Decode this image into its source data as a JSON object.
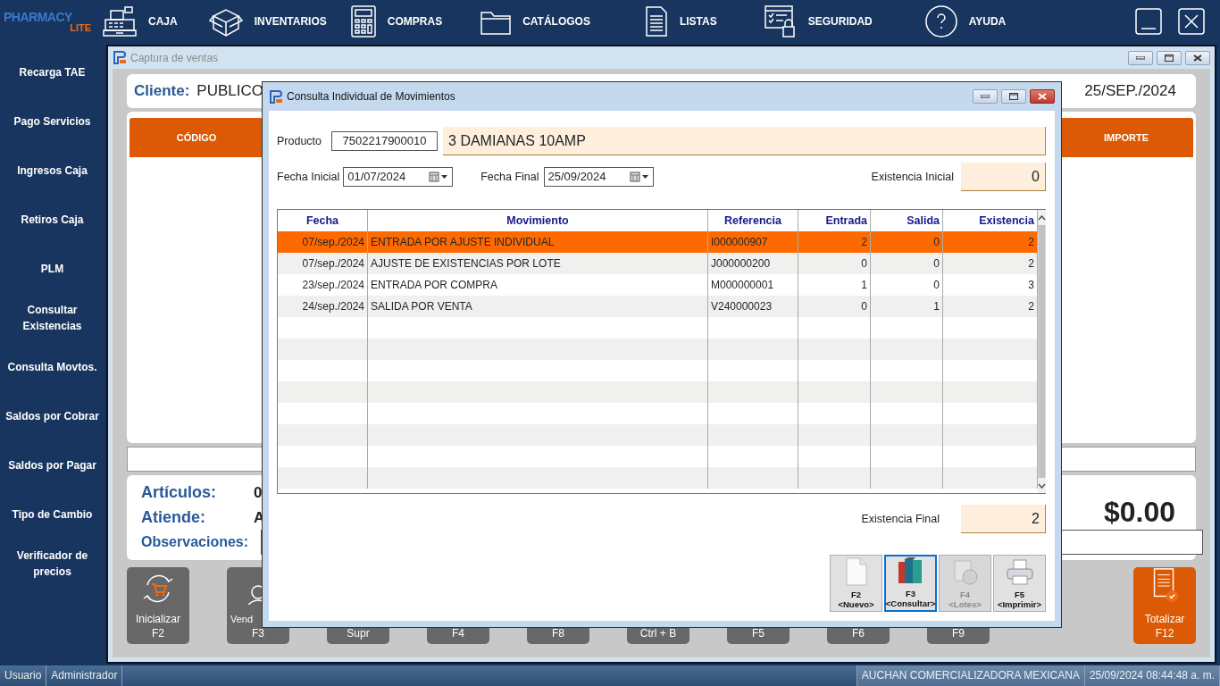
{
  "app": {
    "logo_line1": "PHARMACY",
    "logo_line2": "LITE"
  },
  "menu": [
    {
      "label": "CAJA"
    },
    {
      "label": "INVENTARIOS"
    },
    {
      "label": "COMPRAS"
    },
    {
      "label": "CATÁLOGOS"
    },
    {
      "label": "LISTAS"
    },
    {
      "label": "SEGURIDAD"
    },
    {
      "label": "AYUDA"
    }
  ],
  "sidebar": {
    "items": [
      "Recarga TAE",
      "Pago Servicios",
      "Ingresos Caja",
      "Retiros Caja",
      "PLM",
      "Consultar Existencias",
      "Consulta Movtos.",
      "Saldos por Cobrar",
      "Saldos por Pagar",
      "Tipo  de Cambio",
      "Verificador de precios"
    ]
  },
  "sales_window": {
    "title": "Captura de ventas",
    "client_label": "Cliente:",
    "client": "PUBLICO",
    "date": "25/SEP./2024",
    "columns": [
      "CÓDIGO",
      "IMPORTE"
    ],
    "items_label": "Artículos:",
    "items_value": "0",
    "attendant_label": "Atiende:",
    "attendant_value": "A",
    "notes_label": "Observaciones:",
    "total": "$0.00",
    "buttons": [
      {
        "kind": "normal",
        "label": "Inicializar",
        "key": "F2"
      },
      {
        "kind": "normal",
        "label": "Vend",
        "key": "F3"
      },
      {
        "kind": "normal",
        "key": "Supr"
      },
      {
        "kind": "normal",
        "key": "F4"
      },
      {
        "kind": "normal",
        "key": "F8"
      },
      {
        "kind": "normal",
        "key": "Ctrl + B"
      },
      {
        "kind": "normal",
        "key": "F5"
      },
      {
        "kind": "normal",
        "key": "F6"
      },
      {
        "kind": "normal",
        "key": "F9"
      },
      {
        "kind": "primary",
        "label": "Totalizar",
        "key": "F12"
      }
    ]
  },
  "dialog": {
    "title": "Consulta Individual de Movimientos",
    "product_label": "Producto",
    "product_code": "7502217900010",
    "product_name": "3 DAMIANAS 10AMP",
    "start_label": "Fecha Inicial",
    "start_date": "01/07/2024",
    "end_label": "Fecha Final",
    "end_date": "25/09/2024",
    "initial_label": "Existencia Inicial",
    "initial_value": "0",
    "table": {
      "columns": [
        "Fecha",
        "Movimiento",
        "Referencia",
        "Entrada",
        "Salida",
        "Existencia"
      ],
      "rows": [
        {
          "selected": true,
          "cells": [
            "07/sep./2024",
            "ENTRADA POR AJUSTE INDIVIDUAL",
            "I000000907",
            "2",
            "0",
            "2"
          ]
        },
        {
          "selected": false,
          "cells": [
            "07/sep./2024",
            "AJUSTE DE EXISTENCIAS POR LOTE",
            "J000000200",
            "0",
            "0",
            "2"
          ]
        },
        {
          "selected": false,
          "cells": [
            "23/sep./2024",
            "ENTRADA POR COMPRA",
            "M000000001",
            "1",
            "0",
            "3"
          ]
        },
        {
          "selected": false,
          "cells": [
            "24/sep./2024",
            "SALIDA POR VENTA",
            "V240000023",
            "0",
            "1",
            "2"
          ]
        }
      ]
    },
    "final_label": "Existencia Final",
    "final_value": "2",
    "buttons": [
      {
        "key": "F2",
        "label": "<Nuevo>",
        "disabled": false,
        "focused": false
      },
      {
        "key": "F3",
        "label": "<Consultar>",
        "disabled": false,
        "focused": true
      },
      {
        "key": "F4",
        "label": "<Lotes>",
        "disabled": true,
        "focused": false
      },
      {
        "key": "F5",
        "label": "<Imprimir>",
        "disabled": false,
        "focused": false
      }
    ]
  },
  "status_bar": {
    "user_label": "Usuario",
    "user": "Administrador",
    "company": "AUCHAN COMERCIALIZADORA MEXICANA",
    "datetime": "25/09/2024 08:44:48 a. m."
  }
}
